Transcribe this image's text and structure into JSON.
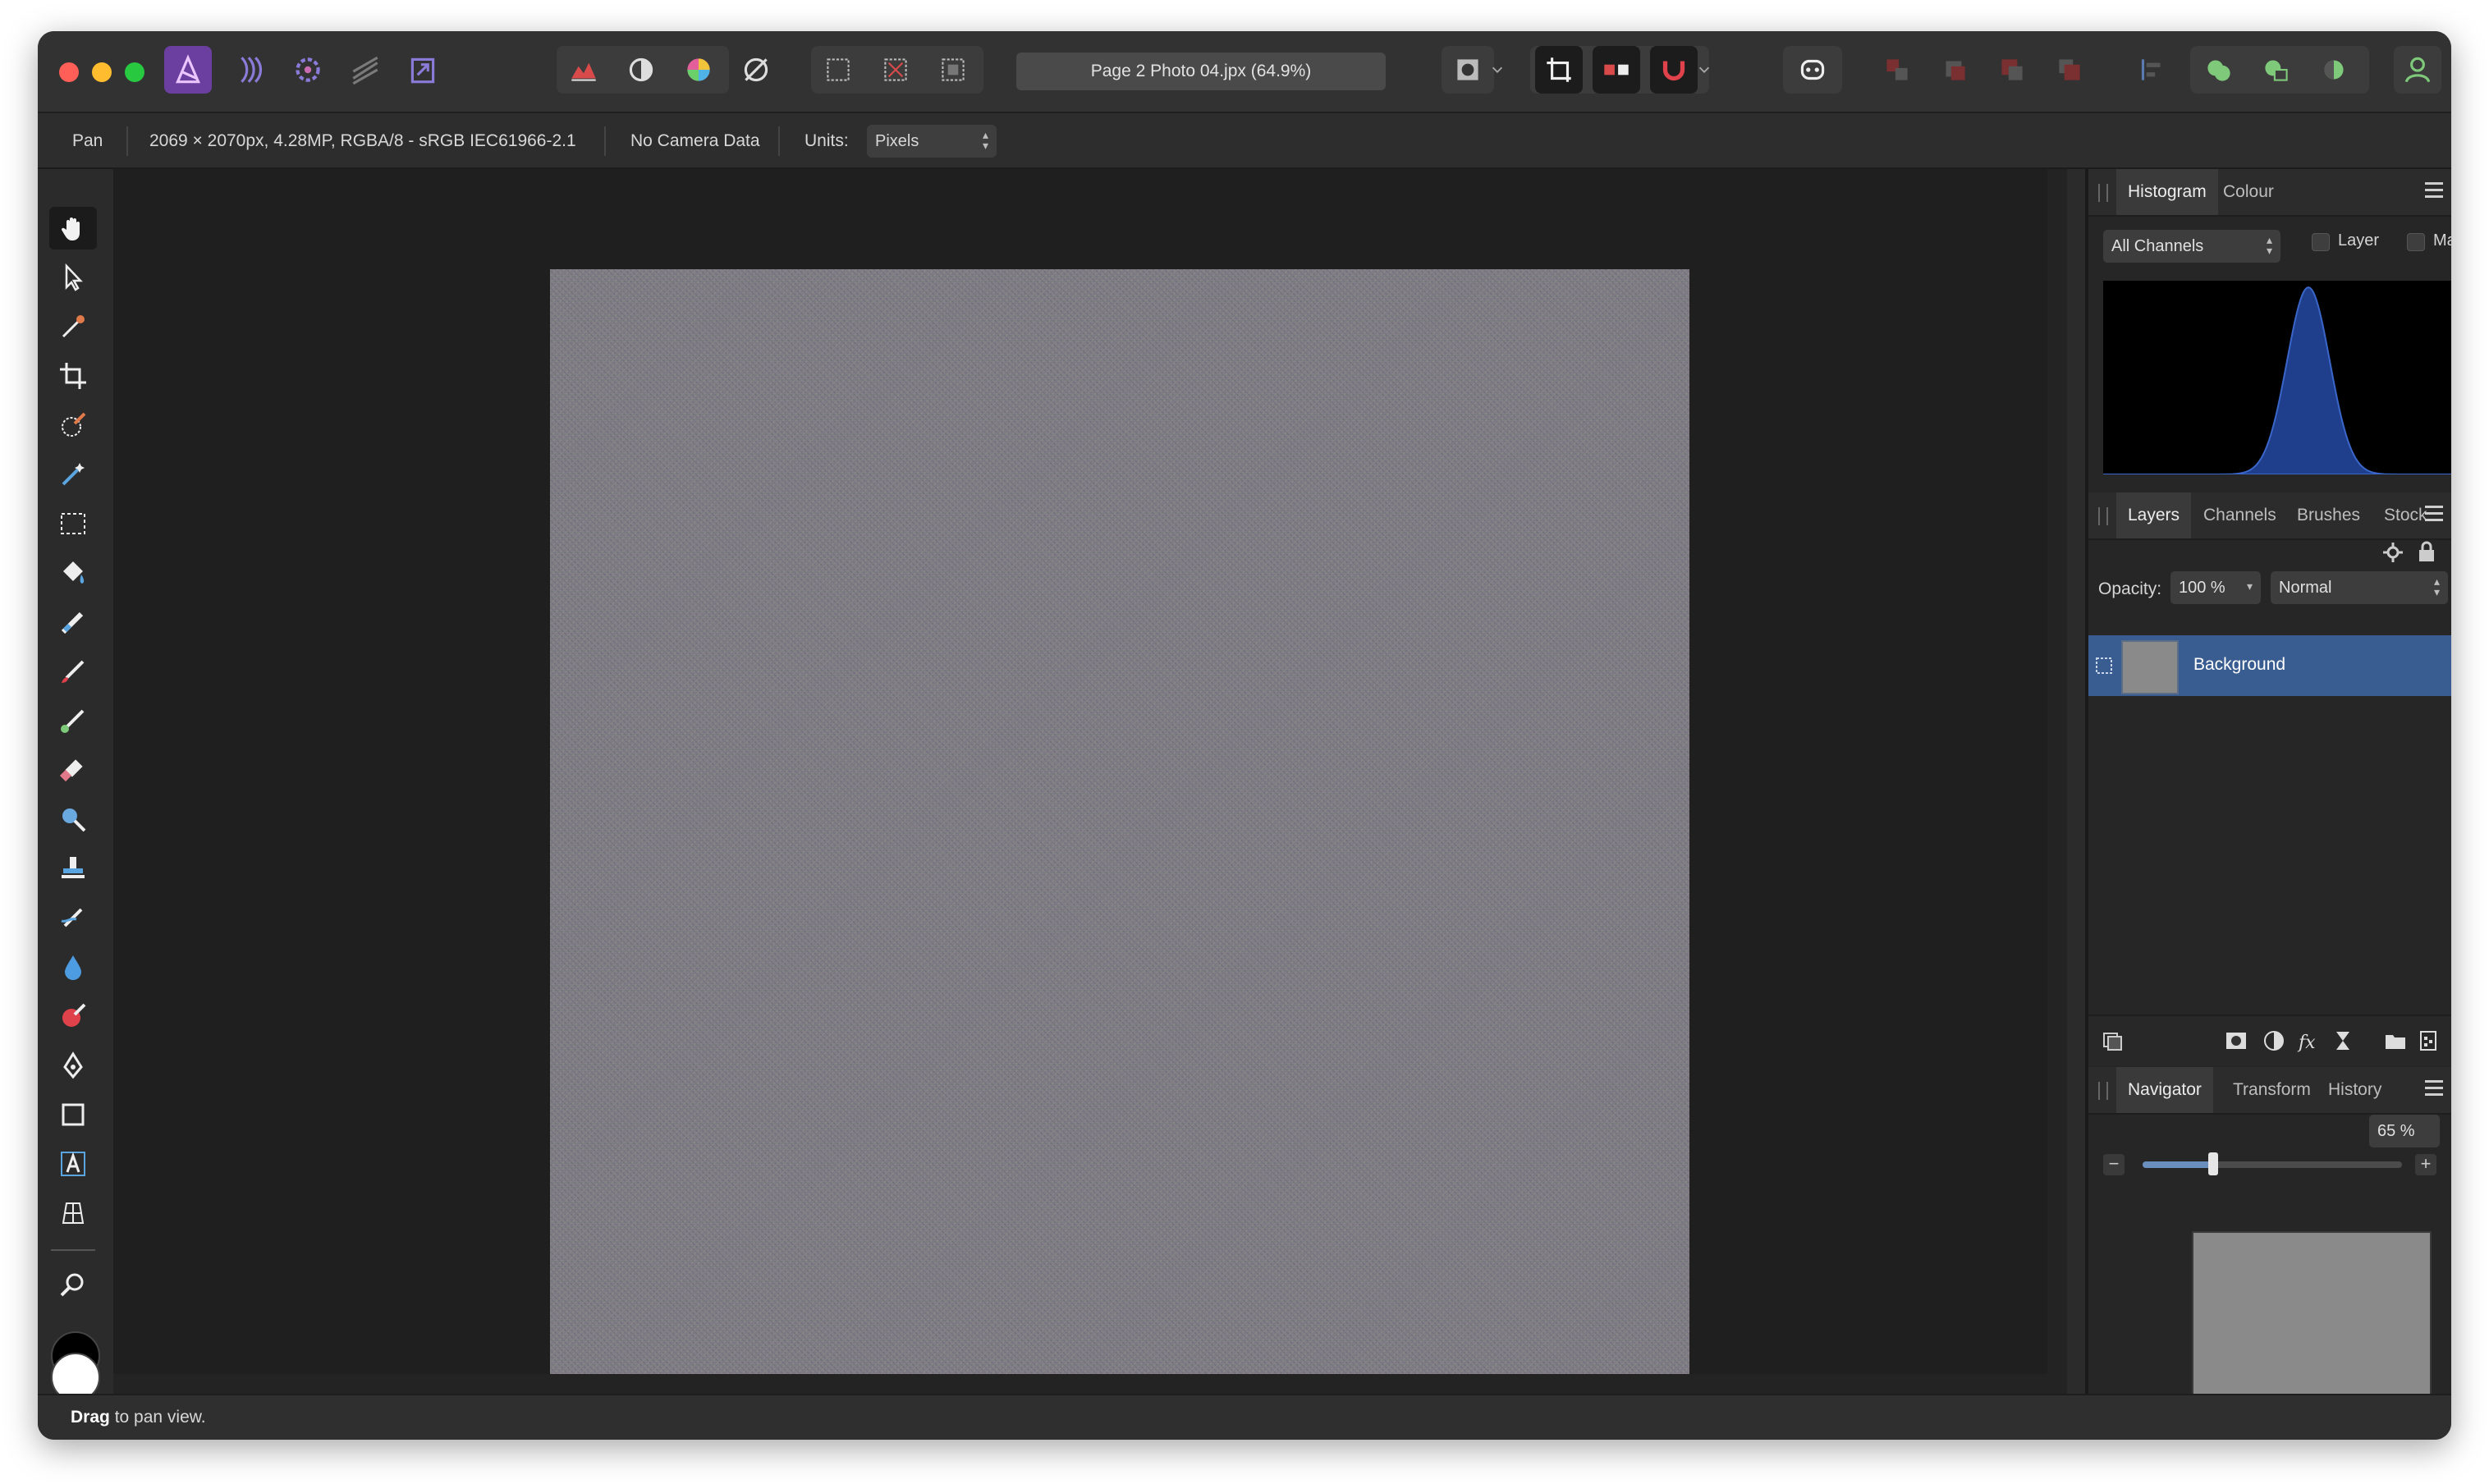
{
  "window": {
    "document_title": "Page 2 Photo 04.jpx (64.9%)"
  },
  "personas": [
    {
      "name": "photo-persona-icon"
    },
    {
      "name": "liquify-persona-icon"
    },
    {
      "name": "develop-persona-icon"
    },
    {
      "name": "tone-mapping-persona-icon"
    },
    {
      "name": "export-persona-icon"
    }
  ],
  "context_bar": {
    "tool": "Pan",
    "image_info": "2069 × 2070px, 4.28MP, RGBA/8 - sRGB IEC61966-2.1",
    "camera": "No Camera Data",
    "units_label": "Units:",
    "units_value": "Pixels"
  },
  "histogram_panel": {
    "tabs": [
      "Histogram",
      "Colour"
    ],
    "active_tab": "Histogram",
    "channel": "All Channels",
    "layer_label": "Layer",
    "marquee_label": "Marquee",
    "warning": true,
    "curve_color": "#1f3f8c"
  },
  "layers_panel": {
    "tabs": [
      "Layers",
      "Channels",
      "Brushes",
      "Stock"
    ],
    "active_tab": "Layers",
    "opacity_label": "Opacity:",
    "opacity_value": "100 %",
    "blend_mode": "Normal",
    "layers": [
      {
        "name": "Background",
        "locked": true,
        "visible": true,
        "selected": true
      }
    ]
  },
  "navigator_panel": {
    "tabs": [
      "Navigator",
      "Transform",
      "History"
    ],
    "active_tab": "Navigator",
    "zoom_value": "65 %",
    "zoom_fraction": 0.65
  },
  "status_bar": {
    "bold": "Drag",
    "text": " to pan view."
  },
  "colors": {
    "accent": "#3a5d91",
    "window_bg": "#2b2b2b",
    "canvas_bg": "#1f1f1f"
  }
}
